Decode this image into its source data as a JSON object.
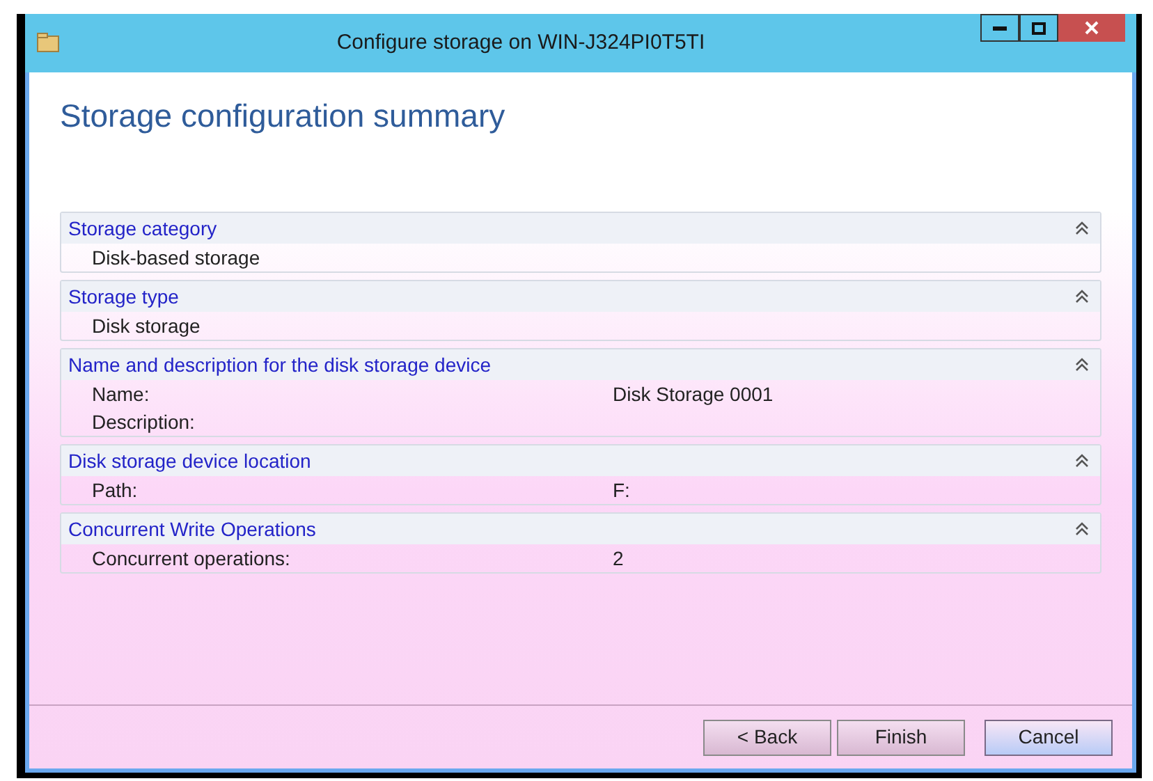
{
  "window": {
    "title": "Configure storage on WIN-J324PI0T5TI"
  },
  "heading": "Storage configuration summary",
  "sections": [
    {
      "title": "Storage category",
      "expanded": true,
      "rows": [
        {
          "label": "Disk-based storage"
        }
      ]
    },
    {
      "title": "Storage type",
      "expanded": true,
      "rows": [
        {
          "label": "Disk storage"
        }
      ]
    },
    {
      "title": "Name and description for the disk storage device",
      "expanded": true,
      "rows": [
        {
          "label": "Name:",
          "value": "Disk Storage 0001"
        },
        {
          "label": "Description:"
        }
      ]
    },
    {
      "title": "Disk storage device location",
      "expanded": true,
      "rows": [
        {
          "label": "Path:",
          "value": "F:"
        }
      ]
    },
    {
      "title": "Concurrent Write Operations",
      "expanded": true,
      "rows": [
        {
          "label": "Concurrent operations:",
          "value": "2"
        }
      ]
    }
  ],
  "buttons": [
    {
      "label": "< Back",
      "default": false
    },
    {
      "label": "Finish",
      "default": false
    },
    {
      "label": "Cancel",
      "default": true
    }
  ]
}
